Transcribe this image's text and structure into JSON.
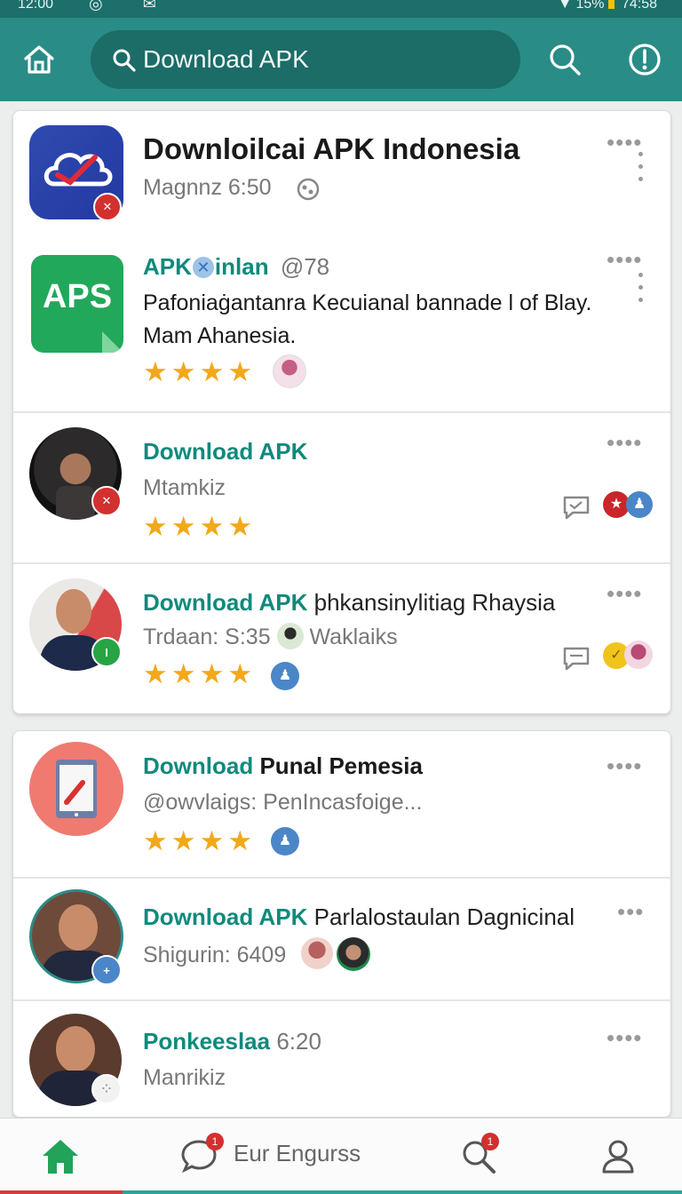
{
  "status_bar": {
    "time": "12:00",
    "battery_text": "15%",
    "right_text": "74:58"
  },
  "header": {
    "search_text": "Download APK"
  },
  "card1": {
    "app_header": {
      "title": "Downloilcai  APK Indonesia",
      "subtitle": "Magnnz 6:50"
    },
    "row1": {
      "title_a": "APK",
      "title_b": "inlan",
      "title_c": "@78",
      "desc_line1": "Pafoniaġantanra Kecuianal bannade l of Blay.",
      "desc_line2": "Mam Ahanesia.",
      "stars": "★★★★",
      "icon_text": "APS"
    },
    "row2": {
      "title": "Download APK",
      "subtitle": "Mtamkiz",
      "stars": "★★★★"
    },
    "row3": {
      "title_a": "Download APK",
      "title_b": "þhkansinylitiag Rhaysia",
      "subtitle_a": "Trdaan: S:35",
      "subtitle_b": "Waklaiks",
      "stars": "★★★★"
    }
  },
  "card2": {
    "row1": {
      "title_a": "Download",
      "title_b": "Punal Pemesia",
      "subtitle": "@owvlaigs: PenIncasfoige...",
      "stars": "★★★★"
    },
    "row2": {
      "title_a": "Download APK",
      "title_b": "Parlalostaulan Dagnicinal",
      "subtitle": "Shigurin: 6409"
    },
    "row3": {
      "title_a": "Ponkeeslaa",
      "title_b": "6:20",
      "subtitle": "Manrikiz"
    }
  },
  "bottom_nav": {
    "label": "Eur Engurss",
    "badge1": "1",
    "badge2": "1"
  },
  "colors": {
    "header": "#2a8c86",
    "accent_green": "#0f8a7c",
    "star": "#f2a819",
    "badge_red": "#d42f2f"
  },
  "icons": [
    "home-icon",
    "search-icon",
    "alert-icon",
    "more-icon",
    "chat-icon",
    "user-icon"
  ]
}
